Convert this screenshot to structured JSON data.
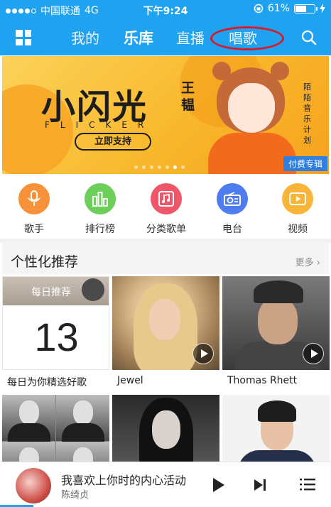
{
  "status_bar": {
    "carrier": "中国联通",
    "network": "4G",
    "time": "下午9:24",
    "battery": "61%",
    "battery_level": 0.61
  },
  "nav": {
    "tabs": [
      {
        "label": "我的"
      },
      {
        "label": "乐库"
      },
      {
        "label": "直播"
      },
      {
        "label": "唱歌"
      }
    ],
    "active_tab": "乐库",
    "highlighted_tab": "唱歌"
  },
  "banner": {
    "title": "小闪光",
    "subtitle": "FLICKER",
    "artist": "王韫",
    "button": "立即支持",
    "side_text": "陌陌音乐计划",
    "tag": "付费专辑",
    "dot_count": 7,
    "active_dot": 5
  },
  "categories": [
    {
      "label": "歌手",
      "icon": "microphone-icon",
      "color": "#f7923a"
    },
    {
      "label": "排行榜",
      "icon": "bar-chart-icon",
      "color": "#6ccf5a"
    },
    {
      "label": "分类歌单",
      "icon": "music-note-icon",
      "color": "#f0566a"
    },
    {
      "label": "电台",
      "icon": "radio-icon",
      "color": "#4f7df0"
    },
    {
      "label": "视频",
      "icon": "video-play-icon",
      "color": "#f9b43a"
    }
  ],
  "recommend": {
    "title": "个性化推荐",
    "more": "更多",
    "cards": [
      {
        "label": "每日为你精选好歌",
        "top_text": "每日推荐",
        "day": "13"
      },
      {
        "label": "Jewel"
      },
      {
        "label": "Thomas Rhett"
      }
    ]
  },
  "player": {
    "song": "我喜欢上你时的内心活动",
    "artist": "陈绮贞",
    "progress": 0.1
  },
  "colors": {
    "header_blue": "#1fa3f0",
    "highlight_red": "#d81a2c"
  }
}
